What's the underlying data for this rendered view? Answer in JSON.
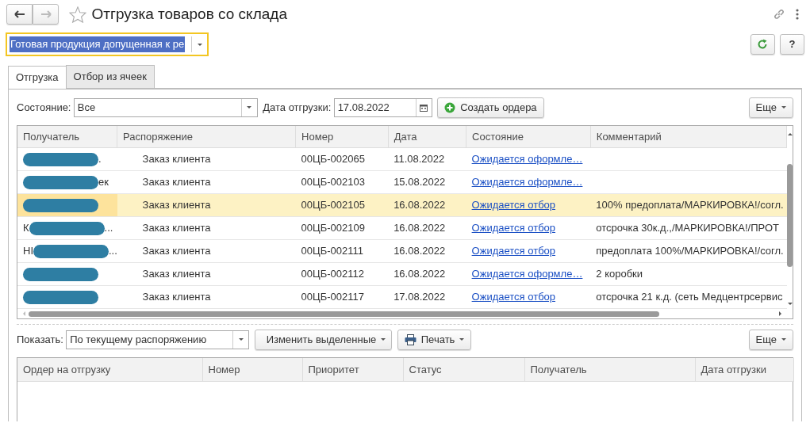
{
  "nav": {
    "back_disabled": false,
    "forward_disabled": true
  },
  "favorite": {
    "on": false
  },
  "help_button": "?",
  "title": "Отгрузка товаров со склада",
  "warehouse": {
    "value": "Готовая продукция допущенная к ре",
    "focused": true,
    "text_highlighted": true
  },
  "tabs": [
    {
      "label": "Отгрузка",
      "selected": true
    },
    {
      "label": "Отбор из ячеек",
      "selected": false
    }
  ],
  "filters": {
    "state_label": "Состояние:",
    "state_value": "Все",
    "date_label": "Дата отгрузки:",
    "date_value": "17.08.2022",
    "create_button": "Создать ордера",
    "more_button": "Еще"
  },
  "orders_table": {
    "columns": [
      "Получатель",
      "Распоряжение",
      "Номер",
      "Дата",
      "Состояние",
      "Комментарий"
    ],
    "rows": [
      {
        "recipient_suffix": ".",
        "redacted": true,
        "order_type": "Заказ клиента",
        "number": "00ЦБ-002065",
        "date": "11.08.2022",
        "status": "Ожидается оформле…",
        "selected": false
      },
      {
        "recipient_suffix": "ек",
        "redacted": true,
        "order_type": "Заказ клиента",
        "number": "00ЦБ-002103",
        "date": "15.08.2022",
        "status": "Ожидается оформле…",
        "selected": false
      },
      {
        "redacted": true,
        "order_type": "Заказ клиента",
        "number": "00ЦБ-002105",
        "date": "16.08.2022",
        "status": "Ожидается отбор",
        "comment": "100% предоплата/МАРКИРОВКА!/согл.",
        "selected": true
      },
      {
        "recipient_prefix": "К",
        "recipient_suffix": "...",
        "redacted": true,
        "order_type": "Заказ клиента",
        "number": "00ЦБ-002109",
        "date": "16.08.2022",
        "status": "Ожидается отбор",
        "comment": "отсрочка 30к.д.,/МАРКИРОВКА!/ПРОТ",
        "selected": false
      },
      {
        "recipient_prefix": "НІ",
        "recipient_suffix": "...",
        "redacted": true,
        "order_type": "Заказ клиента",
        "number": "00ЦБ-002111",
        "date": "16.08.2022",
        "status": "Ожидается отбор",
        "comment": "предоплата 100%/МАРКИРОВКА!/согл.",
        "selected": false
      },
      {
        "redacted": true,
        "order_type": "Заказ клиента",
        "number": "00ЦБ-002112",
        "date": "16.08.2022",
        "status": "Ожидается оформле…",
        "comment": "2 коробки",
        "selected": false
      },
      {
        "redacted": true,
        "order_type": "Заказ клиента",
        "number": "00ЦБ-002117",
        "date": "17.08.2022",
        "status": "Ожидается отбор",
        "comment": "отсрочка 21 к.д. (сеть Медцентрсервис",
        "selected": false
      }
    ]
  },
  "bottom": {
    "show_label": "Показать:",
    "show_value": "По текущему распоряжению",
    "change_button": "Изменить выделенные",
    "print_button": "Печать",
    "more_button": "Еще"
  },
  "shipments_table": {
    "columns": [
      "Ордер на отгрузку",
      "Номер",
      "Приоритет",
      "Статус",
      "Получатель",
      "Дата отгрузки"
    ]
  }
}
